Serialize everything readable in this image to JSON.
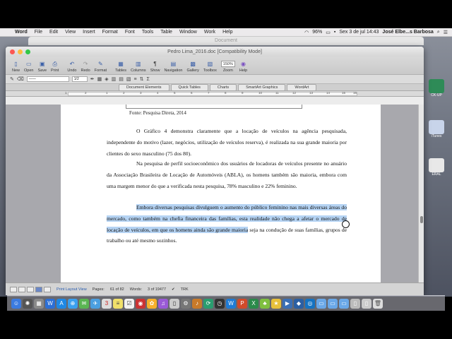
{
  "menubar": {
    "app_name": "Word",
    "items": [
      "File",
      "Edit",
      "View",
      "Insert",
      "Format",
      "Font",
      "Tools",
      "Table",
      "Window",
      "Work",
      "Help"
    ],
    "battery": "96%",
    "datetime": "Sex 3 de jul  14:43",
    "user": "José Elbe...s Barbosa"
  },
  "background_window": {
    "title": "Document"
  },
  "window": {
    "title": "Pedro Lima_2016.doc [Compatibility Mode]"
  },
  "toolbar": {
    "buttons": [
      "New",
      "Open",
      "Save",
      "Print",
      "Undo",
      "Redo",
      "Format",
      "Tables",
      "Columns",
      "Show",
      "Navigation",
      "Gallery",
      "Toolbox",
      "Zoom",
      "Help"
    ],
    "zoom_value": "150%"
  },
  "formatbar": {
    "size_value": "1/2"
  },
  "ribbon": {
    "tabs": [
      "Document Elements",
      "Quick Tables",
      "Charts",
      "SmartArt Graphics",
      "WordArt"
    ]
  },
  "ruler": {
    "ticks": [
      "1",
      "2",
      "1",
      "2",
      "3",
      "4",
      "5",
      "6",
      "7",
      "8",
      "9",
      "10",
      "11",
      "12",
      "13",
      "14",
      "15",
      "16"
    ]
  },
  "document": {
    "caption": "Fonte: Pesquisa Direta, 2014",
    "p1": "O Gráfico 4 demonstra claramente que a locação de veículos na agência pesquisada, independente do motivo (lazer, negócios, utilização de veículos reserva), é realizada na sua grande maioria por clientes do sexo masculino (75 dos 80).",
    "p2": "Na pesquisa de perfil socioeconômico dos usuários de locadoras de veículos presente no anuário da Associação Brasileira de Locação de Automóveis (ABLA), os homens também são maioria, embora com uma margem menor do que a verificada nesta pesquisa, 78% masculino e 22% feminino.",
    "p3_highlighted": "Embora diversas pesquisas divulguem o aumento do público feminino nas mais diversas áreas do mercado, como também na chefia financeira das famílias, esta realidade não chega a afetar o mercado de locação de veículos, em que os homens ainda são grande maioria",
    "p3_rest": " seja na condução de suas famílias, grupos de trabalho ou até mesmo sozinhos."
  },
  "statusbar": {
    "view": "Print Layout View",
    "pages_label": "Pages:",
    "pages_value": "61 of 82",
    "words_label": "Words:",
    "words_value": "3 of 19477",
    "trk": "TRK"
  },
  "desktop": {
    "icons": [
      "CK-UP",
      "iTunes",
      "ERAL"
    ]
  },
  "colors": {
    "selection": "#b5d3f3",
    "accent": "#2a5db0"
  }
}
